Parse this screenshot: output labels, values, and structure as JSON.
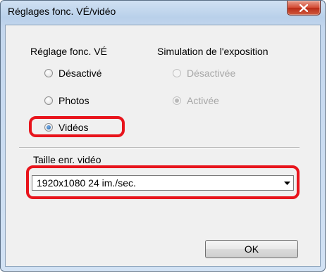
{
  "window": {
    "title": "Réglages fonc. VÉ/vidéo",
    "close_glyph": "✕"
  },
  "live_view": {
    "heading": "Réglage fonc. VÉ",
    "options": [
      {
        "label": "Désactivé",
        "checked": false
      },
      {
        "label": "Photos",
        "checked": false
      },
      {
        "label": "Vidéos",
        "checked": true
      }
    ]
  },
  "exposure_sim": {
    "heading": "Simulation de l'exposition",
    "options": [
      {
        "label": "Désactivée",
        "checked": false,
        "enabled": false
      },
      {
        "label": "Activée",
        "checked": true,
        "enabled": false
      }
    ]
  },
  "movie_size": {
    "label": "Taille enr. vidéo",
    "selected": "1920x1080  24 im./sec."
  },
  "buttons": {
    "ok": "OK"
  },
  "colors": {
    "highlight": "#e8141c",
    "accent": "#1d5ea8"
  }
}
